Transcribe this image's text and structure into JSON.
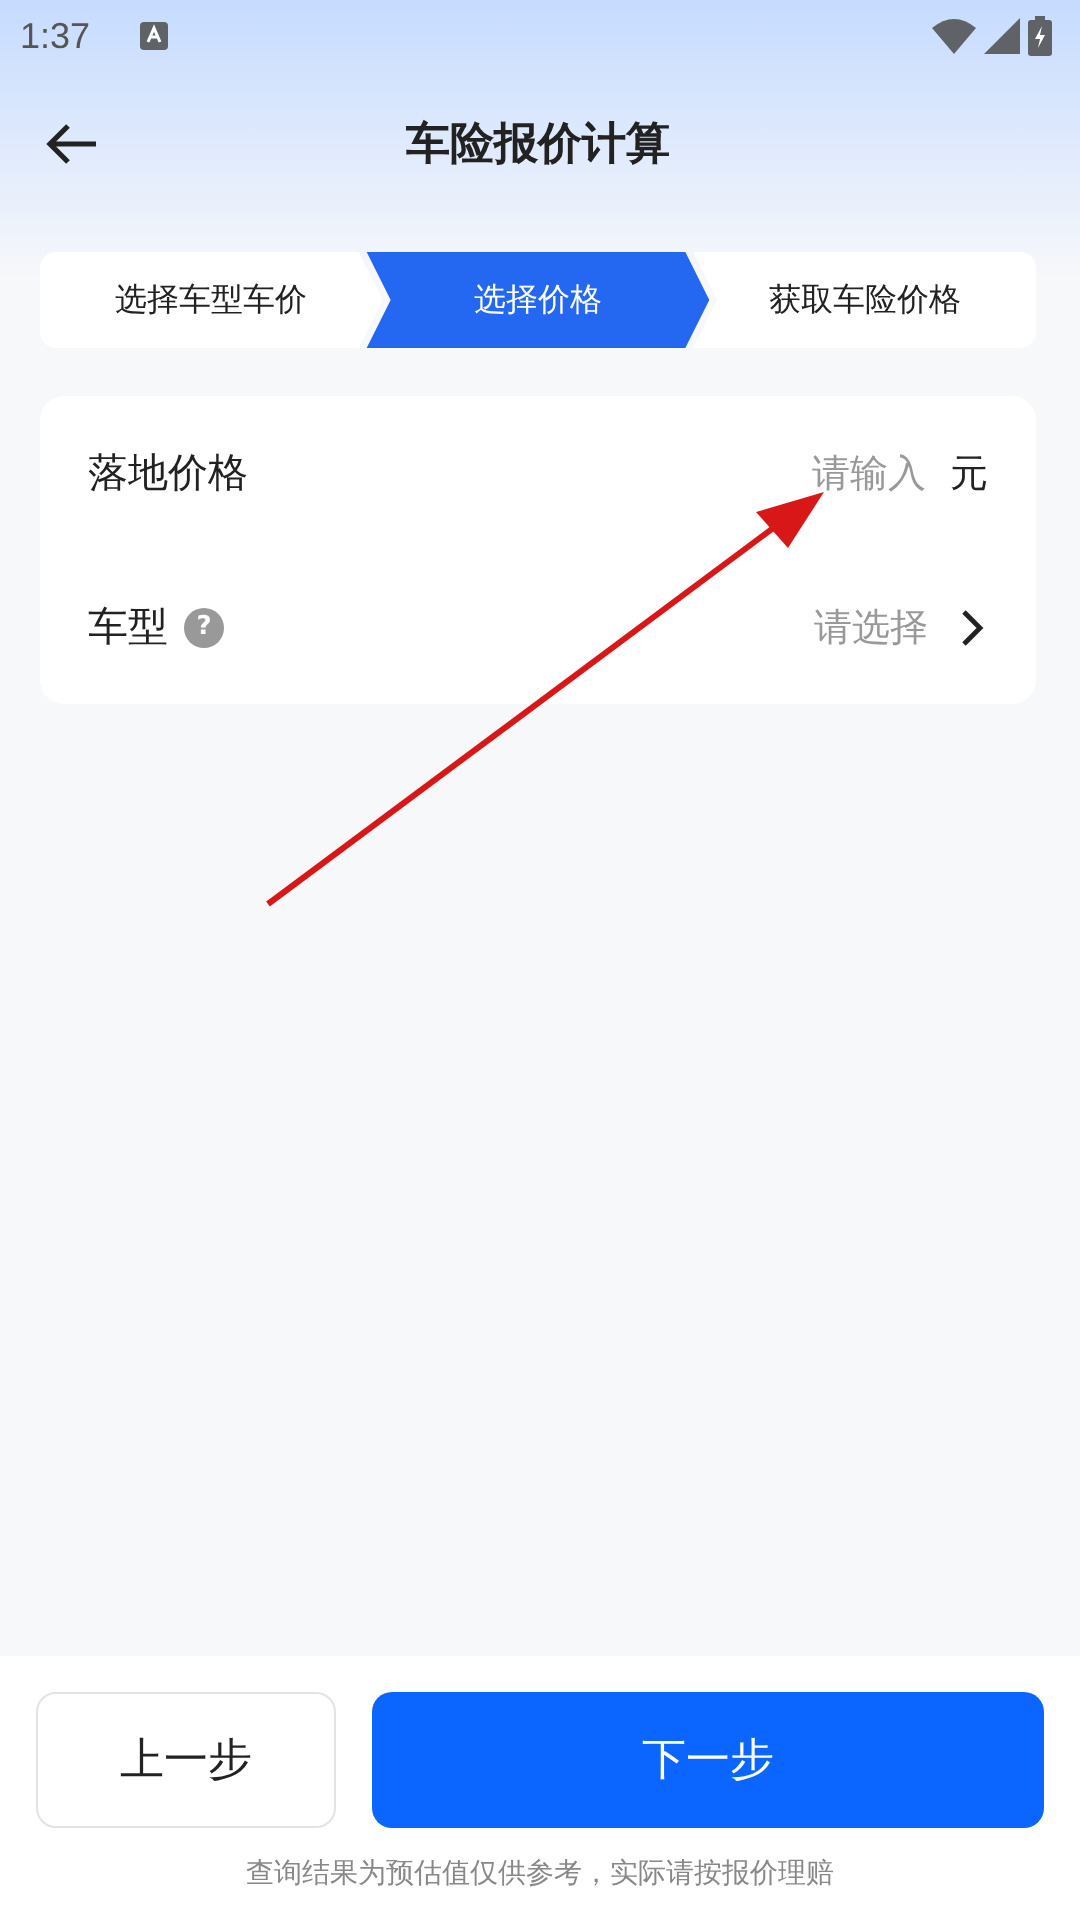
{
  "status_bar": {
    "time": "1:37"
  },
  "header": {
    "title": "车险报价计算"
  },
  "steps": [
    {
      "label": "选择车型车价",
      "selected": false
    },
    {
      "label": "选择价格",
      "selected": true
    },
    {
      "label": "获取车险价格",
      "selected": false
    }
  ],
  "form": [
    {
      "kind": "input",
      "label": "落地价格",
      "placeholder": "请输入",
      "unit": "元"
    },
    {
      "kind": "select",
      "label": "车型",
      "help": "?",
      "placeholder": "请选择"
    }
  ],
  "buttons": [
    {
      "kind": "secondary",
      "label": "上一步"
    },
    {
      "kind": "primary",
      "label": "下一步"
    }
  ],
  "footnote": "查询结果为预估值仅供参考，实际请按报价理赔"
}
